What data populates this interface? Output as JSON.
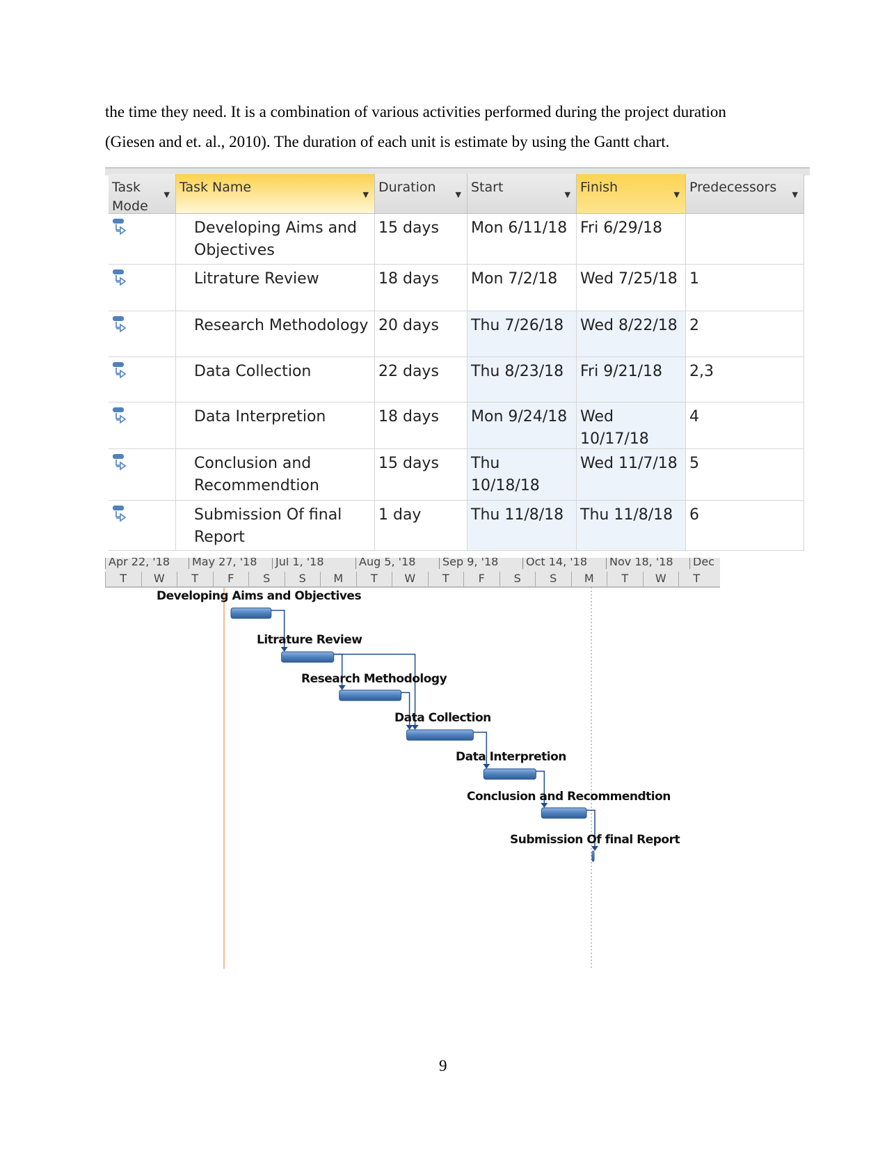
{
  "paragraph": {
    "line1": "the time they need. It is a combination of various activities performed during the project duration",
    "line2": "(Giesen and et. al., 2010). The duration of each unit is estimate by using the Gantt chart."
  },
  "table": {
    "columns": [
      "Task Mode",
      "Task Name",
      "Duration",
      "Start",
      "Finish",
      "Predecessors"
    ],
    "task_mode_icon": "auto-scheduled-task-icon",
    "rows": [
      {
        "name": "Developing Aims and Objectives",
        "duration": "15 days",
        "start": "Mon 6/11/18",
        "finish": "Fri 6/29/18",
        "predecessors": ""
      },
      {
        "name": "Litrature Review",
        "duration": "18 days",
        "start": "Mon 7/2/18",
        "finish": "Wed 7/25/18",
        "predecessors": "1"
      },
      {
        "name": "Research Methodology",
        "duration": "20 days",
        "start": "Thu 7/26/18",
        "finish": "Wed 8/22/18",
        "predecessors": "2"
      },
      {
        "name": "Data Collection",
        "duration": "22 days",
        "start": "Thu 8/23/18",
        "finish": "Fri 9/21/18",
        "predecessors": "2,3"
      },
      {
        "name": "Data Interpretion",
        "duration": "18 days",
        "start": "Mon 9/24/18",
        "finish": "Wed 10/17/18",
        "predecessors": "4"
      },
      {
        "name": "Conclusion and Recommendtion",
        "duration": "15 days",
        "start": "Thu 10/18/18",
        "finish": "Wed 11/7/18",
        "predecessors": "5"
      },
      {
        "name": "Submission Of final Report",
        "duration": "1 day",
        "start": "Thu 11/8/18",
        "finish": "Thu 11/8/18",
        "predecessors": "6"
      }
    ]
  },
  "timescale": {
    "major": [
      "Apr 22, '18",
      "May 27, '18",
      "Jul 1, '18",
      "Aug 5, '18",
      "Sep 9, '18",
      "Oct 14, '18",
      "Nov 18, '18",
      "Dec"
    ],
    "minor": [
      "T",
      "W",
      "T",
      "F",
      "S",
      "S",
      "M",
      "T",
      "W",
      "T",
      "F",
      "S",
      "S",
      "M",
      "T",
      "W",
      "T"
    ]
  },
  "gantt": {
    "labels": [
      "Developing Aims and Objectives",
      "Litrature Review",
      "Research Methodology",
      "Data Collection",
      "Data Interpretion",
      "Conclusion and Recommendtion",
      "Submission Of final Report"
    ],
    "colors": {
      "bar": "#4f81bd",
      "link": "#1f4e8c",
      "project_start_line": "#f4a460",
      "status_line": "#999999"
    }
  },
  "page_number": "9"
}
